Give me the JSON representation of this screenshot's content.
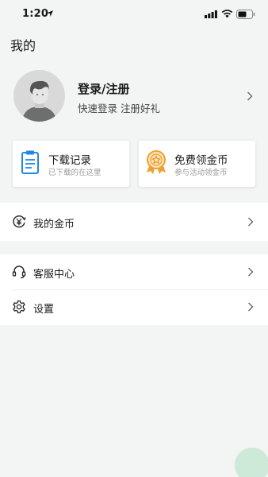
{
  "status_bar": {
    "time": "1:20",
    "icons": [
      "location-arrow-icon",
      "signal-icon",
      "wifi-icon",
      "battery-icon"
    ]
  },
  "header": {
    "title": "我的"
  },
  "profile": {
    "title": "登录/注册",
    "subtitle": "快速登录 注册好礼"
  },
  "cards": {
    "download": {
      "title": "下载记录",
      "subtitle": "已下载的在这里",
      "icon": "clipboard-icon",
      "accent": "#1e88e5"
    },
    "coins": {
      "title": "免费领金币",
      "subtitle": "参与活动领金币",
      "icon": "medal-icon",
      "accent": "#f0a030"
    }
  },
  "menu": {
    "my_coins": {
      "label": "我的金币",
      "icon": "coin-icon"
    },
    "support": {
      "label": "客服中心",
      "icon": "headset-icon"
    },
    "settings": {
      "label": "设置",
      "icon": "gear-icon"
    }
  },
  "colors": {
    "background": "#f3f4f4",
    "floating_button": "#cde9d8"
  }
}
